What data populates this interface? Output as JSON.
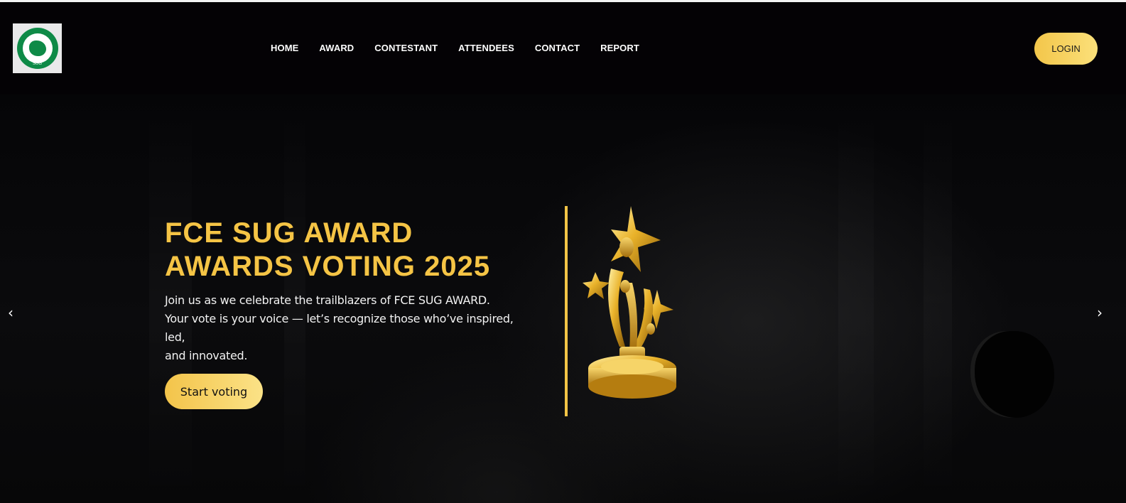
{
  "header": {
    "logo_text": "SUG",
    "nav": [
      {
        "label": "HOME"
      },
      {
        "label": "AWARD"
      },
      {
        "label": "CONTESTANT"
      },
      {
        "label": "ATTENDEES"
      },
      {
        "label": "CONTACT"
      },
      {
        "label": "REPORT"
      }
    ],
    "login_label": "LOGIN"
  },
  "hero": {
    "title_line1": "FCE SUG AWARD",
    "title_line2": "AWARDS VOTING 2025",
    "desc_line1": "Join us as we celebrate the trailblazers of FCE SUG AWARD.",
    "desc_line2": "Your vote is your voice — let’s recognize those who’ve inspired, led,",
    "desc_line3": "and innovated.",
    "cta_label": "Start voting"
  },
  "carousel": {
    "prev_icon": "‹",
    "next_icon": "›"
  },
  "colors": {
    "accent": "#f5c445",
    "background": "#000000"
  }
}
